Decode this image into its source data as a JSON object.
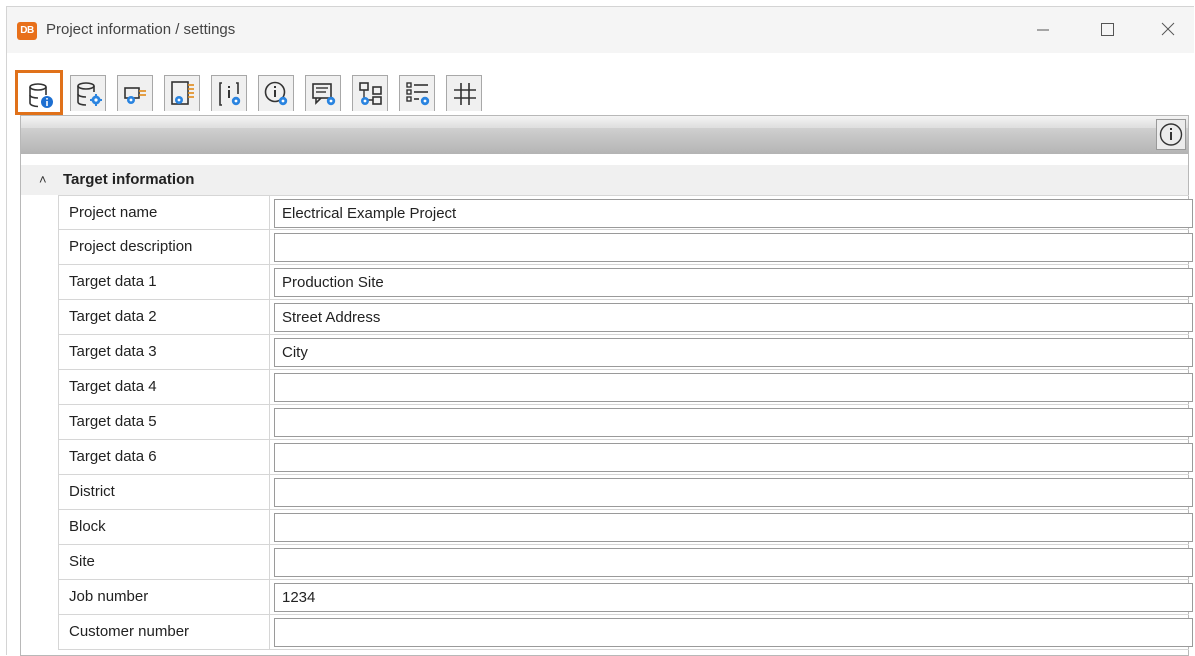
{
  "window": {
    "title": "Project information / settings",
    "logo_text": "DB",
    "accent_color": "#e0711a"
  },
  "toolbar": {
    "tabs": [
      {
        "icon": "database-info-icon",
        "active": true
      },
      {
        "icon": "database-settings-icon",
        "active": false
      },
      {
        "icon": "connector-settings-icon",
        "active": false
      },
      {
        "icon": "multi-connector-settings-icon",
        "active": false
      },
      {
        "icon": "info-page-settings-icon",
        "active": false
      },
      {
        "icon": "info-circle-settings-icon",
        "active": false
      },
      {
        "icon": "message-settings-icon",
        "active": false
      },
      {
        "icon": "hierarchy-settings-icon",
        "active": false
      },
      {
        "icon": "list-settings-icon",
        "active": false
      },
      {
        "icon": "grid-hash-icon",
        "active": false
      }
    ]
  },
  "group": {
    "title": "Target information",
    "expanded": true
  },
  "fields": [
    {
      "label": "Project name",
      "value": "Electrical Example Project"
    },
    {
      "label": "Project description",
      "value": ""
    },
    {
      "label": "Target data 1",
      "value": "Production Site"
    },
    {
      "label": "Target data 2",
      "value": "Street Address"
    },
    {
      "label": "Target data 3",
      "value": "City"
    },
    {
      "label": "Target data 4",
      "value": ""
    },
    {
      "label": "Target data 5",
      "value": ""
    },
    {
      "label": "Target data 6",
      "value": ""
    },
    {
      "label": "District",
      "value": ""
    },
    {
      "label": "Block",
      "value": ""
    },
    {
      "label": "Site",
      "value": ""
    },
    {
      "label": "Job number",
      "value": "1234"
    },
    {
      "label": "Customer number",
      "value": ""
    }
  ]
}
